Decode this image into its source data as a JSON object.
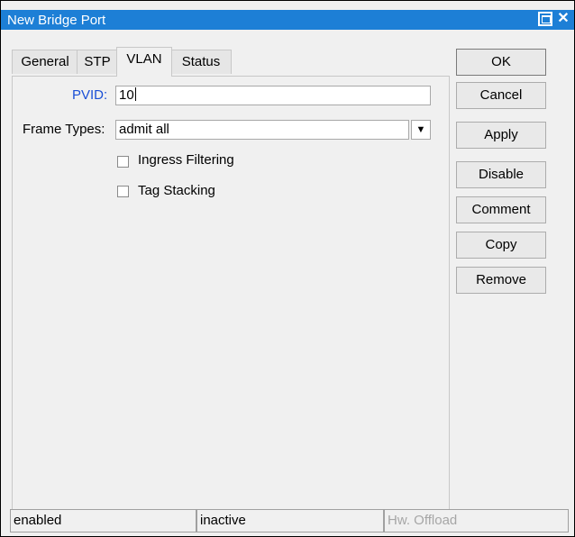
{
  "window": {
    "title": "New Bridge Port"
  },
  "tabs": [
    {
      "label": "General",
      "active": false
    },
    {
      "label": "STP",
      "active": false
    },
    {
      "label": "VLAN",
      "active": true
    },
    {
      "label": "Status",
      "active": false
    }
  ],
  "vlan": {
    "pvid_label": "PVID:",
    "pvid_value": "10",
    "frame_types_label": "Frame Types:",
    "frame_types_value": "admit all",
    "ingress_filtering_label": "Ingress Filtering",
    "ingress_filtering_checked": false,
    "tag_stacking_label": "Tag Stacking",
    "tag_stacking_checked": false
  },
  "buttons": {
    "ok": "OK",
    "cancel": "Cancel",
    "apply": "Apply",
    "disable": "Disable",
    "comment": "Comment",
    "copy": "Copy",
    "remove": "Remove"
  },
  "status_bar": {
    "state": "enabled",
    "status": "inactive",
    "hw_offload": "Hw. Offload"
  },
  "colors": {
    "titlebar": "#1d7fd6",
    "link_label": "#1a4fd6"
  },
  "icons": {
    "restore": "restore-window-icon",
    "close": "close-icon",
    "dropdown": "dropdown-arrow-icon"
  }
}
